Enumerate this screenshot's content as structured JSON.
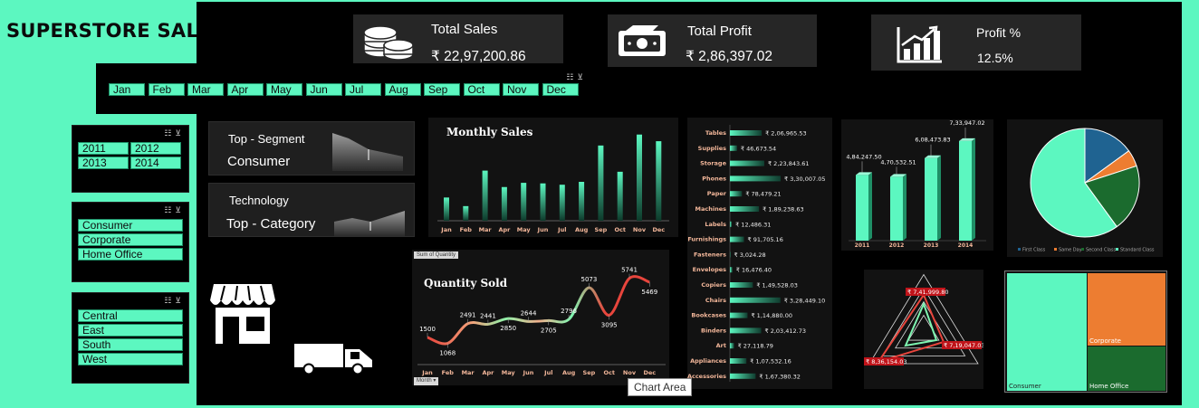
{
  "title": "SUPERSTORE SALES DASHBOARD",
  "kpis": {
    "total_sales_label": "Total Sales",
    "total_sales_value": "₹ 22,97,200.86",
    "total_profit_label": "Total Profit",
    "total_profit_value": "₹ 2,86,397.02",
    "profit_pct_label": "Profit %",
    "profit_pct_value": "12.5%"
  },
  "months": [
    "Jan",
    "Feb",
    "Mar",
    "Apr",
    "May",
    "Jun",
    "Jul",
    "Aug",
    "Sep",
    "Oct",
    "Nov",
    "Dec"
  ],
  "years": [
    "2011",
    "2012",
    "2013",
    "2014"
  ],
  "segments": [
    "Consumer",
    "Corporate",
    "Home Office"
  ],
  "regions": [
    "Central",
    "East",
    "South",
    "West"
  ],
  "cards": {
    "top_segment_label": "Top - Segment",
    "top_segment_value": "Consumer",
    "top_category_value": "Technology",
    "top_category_label": "Top - Category"
  },
  "tooltip": "Chart Area",
  "colors": {
    "accent": "#5cf7c0",
    "background": "#000000",
    "panel": "#262626",
    "red": "#e8453c",
    "pie_blue": "#1f6391",
    "pie_orange": "#ed7d31",
    "pie_green": "#1b6b2e"
  },
  "icons": [
    "coins-icon",
    "cash-icon",
    "growth-chart-icon",
    "store-icon",
    "truck-icon",
    "filter-icon",
    "multiselect-icon"
  ],
  "chart_data": [
    {
      "type": "bar",
      "title": "Monthly Sales",
      "categories": [
        "Jan",
        "Feb",
        "Mar",
        "Apr",
        "May",
        "Jun",
        "Jul",
        "Aug",
        "Sep",
        "Oct",
        "Nov",
        "Dec"
      ],
      "values": [
        94925,
        59751,
        205005,
        137762,
        155028,
        152718,
        147238,
        159044,
        307650,
        200322,
        352461,
        325293
      ],
      "ylim": [
        0,
        370000
      ]
    },
    {
      "type": "line",
      "title": "Quantity Sold",
      "field_button": "Sum of Quantity",
      "axis_button": "Month",
      "categories": [
        "Jan",
        "Feb",
        "Mar",
        "Apr",
        "May",
        "Jun",
        "Jul",
        "Aug",
        "Sep",
        "Oct",
        "Nov",
        "Dec"
      ],
      "values": [
        1500,
        1068,
        2491,
        2441,
        2850,
        2644,
        2705,
        2796,
        5073,
        3095,
        5741,
        5469
      ],
      "labels": [
        "1500",
        "1068",
        "2491",
        "2441",
        "2850",
        "2644",
        "2705",
        "2796",
        "5073",
        "3095",
        "5741",
        "5469"
      ],
      "ylim": [
        0,
        6500
      ]
    },
    {
      "type": "bar",
      "orientation": "horizontal",
      "categories": [
        "Tables",
        "Supplies",
        "Storage",
        "Phones",
        "Paper",
        "Machines",
        "Labels",
        "Furnishings",
        "Fasteners",
        "Envelopes",
        "Copiers",
        "Chairs",
        "Bookcases",
        "Binders",
        "Art",
        "Appliances",
        "Accessories"
      ],
      "values": [
        206965.53,
        46673.54,
        223843.61,
        330007.05,
        78479.21,
        189238.63,
        12486.31,
        91705.16,
        3024.28,
        16476.4,
        149528.03,
        328449.1,
        114880.0,
        203412.73,
        27118.79,
        107532.16,
        167380.32
      ],
      "labels": [
        "₹ 2,06,965.53",
        "₹ 46,673.54",
        "₹ 2,23,843.61",
        "₹ 3,30,007.05",
        "₹ 78,479.21",
        "₹ 1,89,238.63",
        "₹ 12,486.31",
        "₹ 91,705.16",
        "₹ 3,024.28",
        "₹ 16,476.40",
        "₹ 1,49,528.03",
        "₹ 3,28,449.10",
        "₹ 1,14,880.00",
        "₹ 2,03,412.73",
        "₹ 27,118.79",
        "₹ 1,07,532.16",
        "₹ 1,67,380.32"
      ]
    },
    {
      "type": "bar",
      "categories": [
        "2011",
        "2012",
        "2013",
        "2014"
      ],
      "values": [
        484247.5,
        470532.51,
        608473.83,
        733947.02
      ],
      "labels": [
        "4,84,247.50",
        "4,70,532.51",
        "6,08,473.83",
        "7,33,947.02"
      ],
      "ylim": [
        0,
        800000
      ]
    },
    {
      "type": "pie",
      "categories": [
        "First Class",
        "Same Day",
        "Second Class",
        "Standard Class"
      ],
      "values": [
        15.0,
        5.0,
        20.0,
        60.0
      ],
      "legend_position": "bottom"
    },
    {
      "type": "radar",
      "categories": [
        "Top",
        "Right",
        "Left"
      ],
      "values": [
        741999.8,
        719047.03,
        836154.03
      ],
      "labels": [
        "₹ 7,41,999.80",
        "₹ 7,19,047.03",
        "₹ 8,36,154.03"
      ]
    },
    {
      "type": "treemap",
      "categories": [
        "Consumer",
        "Corporate",
        "Home Office"
      ],
      "values": [
        1161401,
        706146,
        429653
      ]
    }
  ]
}
